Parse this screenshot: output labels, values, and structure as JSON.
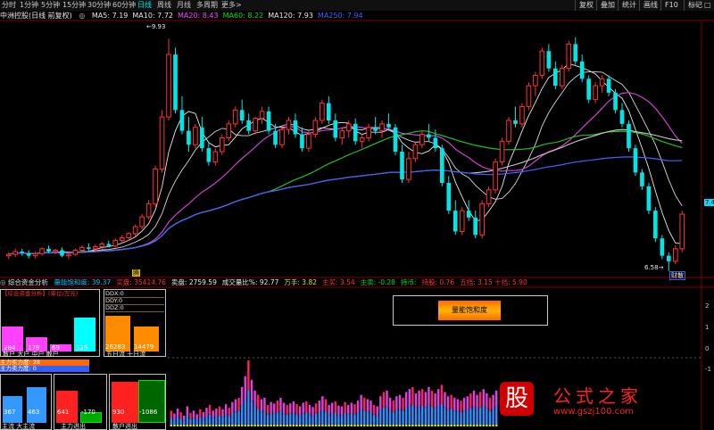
{
  "toolbar": {
    "periods": [
      "分时",
      "1分钟",
      "5分钟",
      "15分钟",
      "30分钟",
      "60分钟",
      "日线",
      "周线",
      "月线",
      "多周期",
      "更多>"
    ],
    "active": "日线",
    "right_buttons": [
      "复权",
      "叠加",
      "统计",
      "画线",
      "F10",
      "标记"
    ],
    "icons": [
      "minus-icon",
      "square-icon"
    ]
  },
  "info": {
    "stock": "中洲控股(日线 前复权)",
    "ma": [
      {
        "label": "MA5:",
        "value": "7.19",
        "color": "#e8e8e8"
      },
      {
        "label": "MA10:",
        "value": "7.72",
        "color": "#e8e8e8"
      },
      {
        "label": "MA20:",
        "value": "8.43",
        "color": "#ff40ff"
      },
      {
        "label": "MA60:",
        "value": "8.22",
        "color": "#00e000"
      },
      {
        "label": "MA120:",
        "value": "7.93",
        "color": "#e8e8e8"
      },
      {
        "label": "MA250:",
        "value": "7.94",
        "color": "#4060ff"
      }
    ]
  },
  "price_labels": {
    "high": "9.93",
    "low": "6.58",
    "right_axis": "7.4"
  },
  "markers": {
    "start": "腾",
    "end": "财散"
  },
  "sub": {
    "title": "综合资金分析",
    "items": [
      {
        "text": "量能饱和度: 39.37",
        "color": "#00c0ff"
      },
      {
        "text": "买盘: 35414.76",
        "color": "#ff3030"
      },
      {
        "text": "卖盘: 2759.59",
        "color": "#e8e8e8"
      },
      {
        "text": "成交量比%: 92.77",
        "color": "#e8e8e8"
      },
      {
        "text": "万手: 3.82",
        "color": "#e0e000"
      },
      {
        "text": "主买: 3.54",
        "color": "#ff3030"
      },
      {
        "text": "主卖: -0.28",
        "color": "#00e000"
      },
      {
        "text": "持币:",
        "color": "#00e000"
      },
      {
        "text": "持股: 0.76",
        "color": "#ff3030"
      },
      {
        "text": "五挡: 3.15 十挡: 5.90",
        "color": "#ff3030"
      }
    ],
    "center_box": "量能饱和度",
    "axis_right": [
      "2",
      "1",
      "0",
      "-1"
    ]
  },
  "panel": {
    "header": "【综合资金分析】(单位/万元)",
    "bars1": [
      {
        "value": "284",
        "color": "#ff40ff"
      },
      {
        "value": "178",
        "color": "#ff40ff"
      },
      {
        "value": "69",
        "color": "#ff40ff"
      },
      {
        "value": "325",
        "color": "#00ffff"
      }
    ],
    "bars1_labels": "散户 大户 中户 散户",
    "ddx": [
      "DDX:0",
      "DDY:0",
      "DDZ:0"
    ],
    "bars2": [
      {
        "value": "26283",
        "color": "#ff8c00"
      },
      {
        "value": "14479",
        "color": "#ff8c00"
      }
    ],
    "bars2_labels": "五日流 十日流",
    "strip1": "主力买力度: 28",
    "strip2": "主力卖力度: 0",
    "bars3": [
      {
        "value": "367",
        "color": "#3399ff"
      },
      {
        "value": "463",
        "color": "#3399ff"
      },
      {
        "value": "641",
        "color": "#ff2020"
      },
      {
        "value": "-170",
        "color": "#00aa00"
      },
      {
        "value": "930",
        "color": "#ff2020"
      },
      {
        "value": "-1086",
        "color": "#006600"
      }
    ],
    "bars3_labels": [
      "主流 大主流",
      "主力进出",
      "散户进出"
    ]
  },
  "watermark": {
    "logo": "股",
    "text": "公式之家",
    "url": "www.gszj100.com"
  },
  "chart_data": {
    "type": "candlestick",
    "candles": [
      [
        6.8,
        6.85,
        6.75,
        6.82
      ],
      [
        6.82,
        6.9,
        6.78,
        6.86
      ],
      [
        6.86,
        6.9,
        6.8,
        6.84
      ],
      [
        6.84,
        6.88,
        6.76,
        6.8
      ],
      [
        6.8,
        6.86,
        6.76,
        6.83
      ],
      [
        6.83,
        6.92,
        6.8,
        6.9
      ],
      [
        6.9,
        6.95,
        6.84,
        6.86
      ],
      [
        6.86,
        6.9,
        6.82,
        6.88
      ],
      [
        6.88,
        6.92,
        6.78,
        6.8
      ],
      [
        6.8,
        6.85,
        6.75,
        6.82
      ],
      [
        6.82,
        6.9,
        6.8,
        6.88
      ],
      [
        6.88,
        6.95,
        6.85,
        6.92
      ],
      [
        6.92,
        6.98,
        6.86,
        6.9
      ],
      [
        6.9,
        6.96,
        6.85,
        6.93
      ],
      [
        6.93,
        7.0,
        6.9,
        6.97
      ],
      [
        6.97,
        7.02,
        6.92,
        6.94
      ],
      [
        6.94,
        7.05,
        6.92,
        7.02
      ],
      [
        7.02,
        7.1,
        6.98,
        7.06
      ],
      [
        7.06,
        7.14,
        7.02,
        7.12
      ],
      [
        7.12,
        7.25,
        7.08,
        7.22
      ],
      [
        7.22,
        7.4,
        7.18,
        7.36
      ],
      [
        7.36,
        7.6,
        7.32,
        7.55
      ],
      [
        7.55,
        8.1,
        7.5,
        8.05
      ],
      [
        8.05,
        8.9,
        8.0,
        8.8
      ],
      [
        8.8,
        9.93,
        8.75,
        9.7
      ],
      [
        9.7,
        9.8,
        8.85,
        8.9
      ],
      [
        8.9,
        9.1,
        8.55,
        8.6
      ],
      [
        8.6,
        8.8,
        8.3,
        8.4
      ],
      [
        8.4,
        8.7,
        8.35,
        8.65
      ],
      [
        8.65,
        8.8,
        8.3,
        8.35
      ],
      [
        8.35,
        8.45,
        8.1,
        8.15
      ],
      [
        8.15,
        8.35,
        8.1,
        8.3
      ],
      [
        8.3,
        8.55,
        8.25,
        8.5
      ],
      [
        8.5,
        8.75,
        8.45,
        8.7
      ],
      [
        8.7,
        8.95,
        8.65,
        8.9
      ],
      [
        8.9,
        9.05,
        8.7,
        8.75
      ],
      [
        8.75,
        8.85,
        8.55,
        8.6
      ],
      [
        8.6,
        8.8,
        8.55,
        8.78
      ],
      [
        8.78,
        8.95,
        8.7,
        8.88
      ],
      [
        8.88,
        8.95,
        8.55,
        8.6
      ],
      [
        8.6,
        8.7,
        8.35,
        8.4
      ],
      [
        8.4,
        8.65,
        8.35,
        8.62
      ],
      [
        8.62,
        8.8,
        8.55,
        8.75
      ],
      [
        8.75,
        8.85,
        8.5,
        8.55
      ],
      [
        8.55,
        8.65,
        8.3,
        8.35
      ],
      [
        8.35,
        8.6,
        8.3,
        8.55
      ],
      [
        8.55,
        8.8,
        8.5,
        8.75
      ],
      [
        8.75,
        9.05,
        8.7,
        9.0
      ],
      [
        9.0,
        9.1,
        8.7,
        8.75
      ],
      [
        8.75,
        8.85,
        8.45,
        8.5
      ],
      [
        8.5,
        8.65,
        8.4,
        8.6
      ],
      [
        8.6,
        8.75,
        8.5,
        8.7
      ],
      [
        8.7,
        8.78,
        8.4,
        8.45
      ],
      [
        8.45,
        8.55,
        8.35,
        8.5
      ],
      [
        8.5,
        8.7,
        8.45,
        8.65
      ],
      [
        8.65,
        8.8,
        8.55,
        8.6
      ],
      [
        8.6,
        8.75,
        8.5,
        8.7
      ],
      [
        8.7,
        8.85,
        8.6,
        8.65
      ],
      [
        8.65,
        8.7,
        8.25,
        8.3
      ],
      [
        8.3,
        8.4,
        7.85,
        7.9
      ],
      [
        7.9,
        8.3,
        7.85,
        8.2
      ],
      [
        8.2,
        8.45,
        8.15,
        8.4
      ],
      [
        8.4,
        8.6,
        8.35,
        8.55
      ],
      [
        8.55,
        8.7,
        8.45,
        8.5
      ],
      [
        8.5,
        8.62,
        8.3,
        8.35
      ],
      [
        8.35,
        8.4,
        7.8,
        7.85
      ],
      [
        7.85,
        7.95,
        7.4,
        7.45
      ],
      [
        7.45,
        7.6,
        7.1,
        7.15
      ],
      [
        7.15,
        7.5,
        7.1,
        7.45
      ],
      [
        7.45,
        7.6,
        7.3,
        7.35
      ],
      [
        7.35,
        7.45,
        7.05,
        7.1
      ],
      [
        7.1,
        7.6,
        7.05,
        7.55
      ],
      [
        7.55,
        7.8,
        7.5,
        7.75
      ],
      [
        7.75,
        8.2,
        7.7,
        8.15
      ],
      [
        8.15,
        8.5,
        8.1,
        8.45
      ],
      [
        8.45,
        8.8,
        8.4,
        8.75
      ],
      [
        8.75,
        8.95,
        8.65,
        8.7
      ],
      [
        8.7,
        9.0,
        8.65,
        8.95
      ],
      [
        8.95,
        9.3,
        8.9,
        9.25
      ],
      [
        9.25,
        9.45,
        9.1,
        9.4
      ],
      [
        9.4,
        9.8,
        9.35,
        9.75
      ],
      [
        9.75,
        9.85,
        9.45,
        9.5
      ],
      [
        9.5,
        9.6,
        9.2,
        9.25
      ],
      [
        9.25,
        9.55,
        9.2,
        9.5
      ],
      [
        9.5,
        9.9,
        9.45,
        9.85
      ],
      [
        9.85,
        9.95,
        9.55,
        9.6
      ],
      [
        9.6,
        9.7,
        9.3,
        9.35
      ],
      [
        9.35,
        9.4,
        9.0,
        9.05
      ],
      [
        9.05,
        9.3,
        9.0,
        9.25
      ],
      [
        9.25,
        9.4,
        9.15,
        9.35
      ],
      [
        9.35,
        9.4,
        9.1,
        9.15
      ],
      [
        9.15,
        9.2,
        8.85,
        8.9
      ],
      [
        8.9,
        9.0,
        8.65,
        8.7
      ],
      [
        8.7,
        8.75,
        8.3,
        8.35
      ],
      [
        8.35,
        8.4,
        7.95,
        8.0
      ],
      [
        8.0,
        8.05,
        7.75,
        7.8
      ],
      [
        7.8,
        7.85,
        7.4,
        7.45
      ],
      [
        7.45,
        7.5,
        7.0,
        7.05
      ],
      [
        7.05,
        7.1,
        6.75,
        6.8
      ],
      [
        6.8,
        6.85,
        6.58,
        6.72
      ],
      [
        6.72,
        6.95,
        6.68,
        6.9
      ],
      [
        6.9,
        7.45,
        6.85,
        7.4
      ]
    ],
    "ylim": [
      6.5,
      10.1
    ],
    "ma_lines": [
      "MA5",
      "MA10",
      "MA20",
      "MA60",
      "MA120",
      "MA250"
    ],
    "volume": [
      22,
      18,
      25,
      20,
      15,
      28,
      19,
      22,
      17,
      24,
      20,
      26,
      30,
      22,
      25,
      28,
      24,
      31,
      26,
      34,
      38,
      40,
      55,
      70,
      92,
      65,
      50,
      44,
      38,
      40,
      30,
      34,
      32,
      36,
      40,
      33,
      30,
      32,
      35,
      31,
      28,
      33,
      35,
      30,
      27,
      32,
      36,
      42,
      38,
      30,
      33,
      35,
      29,
      28,
      34,
      30,
      33,
      31,
      36,
      44,
      40,
      38,
      36,
      30,
      28,
      42,
      48,
      50,
      40,
      36,
      42,
      44,
      40,
      48,
      52,
      55,
      46,
      50,
      52,
      48,
      55,
      50,
      46,
      52,
      58,
      48,
      42,
      44,
      40,
      38,
      36,
      40,
      42,
      46,
      50,
      44,
      48,
      52,
      46,
      40,
      44,
      50
    ]
  }
}
